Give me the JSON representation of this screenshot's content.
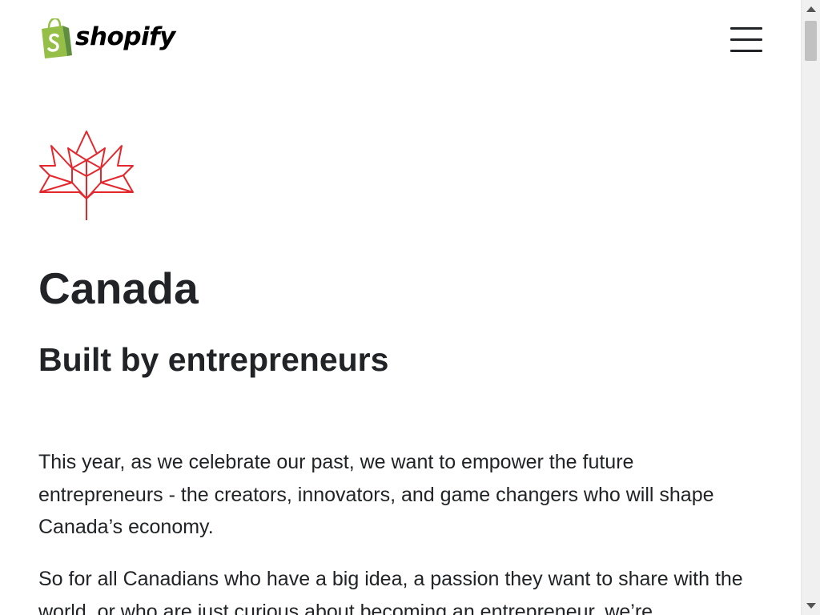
{
  "header": {
    "logo_text": "shopify",
    "menu_icon": "hamburger-menu-icon"
  },
  "hero": {
    "leaf_icon": "maple-leaf-icon",
    "leaf_color": "#e3272d",
    "title": "Canada",
    "subtitle": "Built by entrepreneurs"
  },
  "body": {
    "paragraphs": [
      "This year, as we celebrate our past, we want to empower the future entrepreneurs - the creators, innovators, and game changers who will shape Canada’s economy.",
      "So for all Canadians who have a big idea, a passion they want to share with the world, or who are just curious about becoming an entrepreneur, we’re"
    ]
  },
  "colors": {
    "brand_green": "#95bf47",
    "brand_dark_green": "#5e8e3e",
    "text": "#212326"
  }
}
